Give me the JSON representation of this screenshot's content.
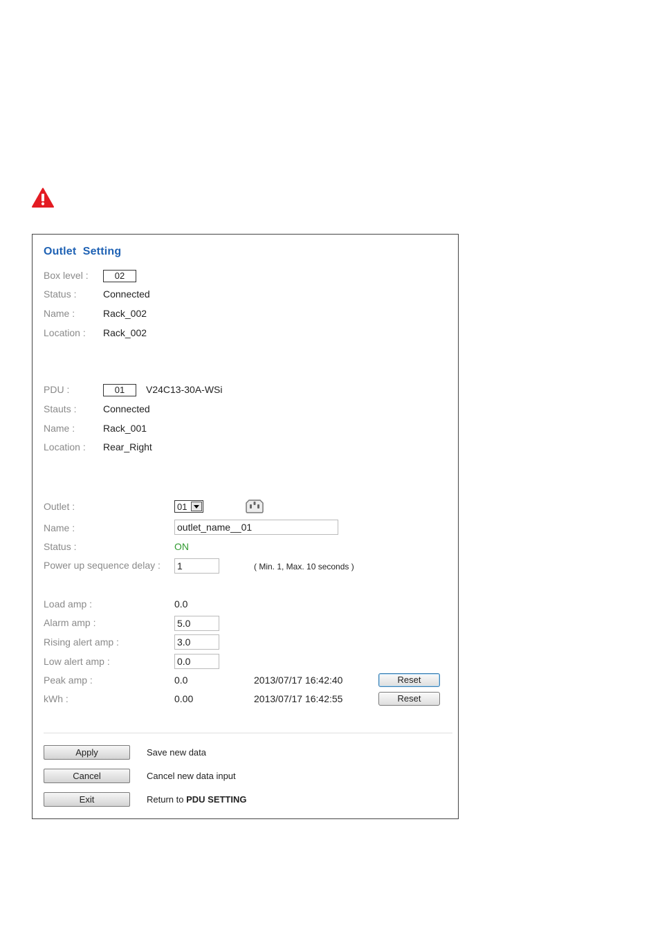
{
  "warning": {
    "icon": "warning-triangle-icon",
    "color": "#e31c23"
  },
  "panel": {
    "title": "Outlet  Setting",
    "title_color": "#1f62b4",
    "box": {
      "level_label": "Box level :",
      "level_value": "02",
      "status_label": "Status :",
      "status_value": "Connected",
      "name_label": "Name :",
      "name_value": "Rack_002",
      "location_label": "Location :",
      "location_value": "Rack_002"
    },
    "pdu": {
      "label": "PDU :",
      "value": "01",
      "model": "V24C13-30A-WSi",
      "status_label": "Stauts :",
      "status_value": "Connected",
      "name_label": "Name :",
      "name_value": "Rack_001",
      "location_label": "Location :",
      "location_value": "Rear_Right"
    },
    "outlet": {
      "label": "Outlet :",
      "selected": "01",
      "icon": "power-outlet-icon",
      "name_label": "Name :",
      "name_value": "outlet_name__01",
      "status_label": "Status :",
      "status_value": "ON",
      "status_color": "#2f9a2f",
      "delay_label": "Power up sequence delay :",
      "delay_value": "1",
      "delay_hint": "( Min. 1, Max. 10 seconds )"
    },
    "amps": {
      "load_label": "Load amp :",
      "load_value": "0.0",
      "alarm_label": "Alarm amp :",
      "alarm_value": "5.0",
      "rising_label": "Rising alert amp :",
      "rising_value": "3.0",
      "low_label": "Low alert amp :",
      "low_value": "0.0",
      "peak_label": "Peak amp :",
      "peak_value": "0.0",
      "peak_time": "2013/07/17 16:42:40",
      "kwh_label": "kWh :",
      "kwh_value": "0.00",
      "kwh_time": "2013/07/17 16:42:55",
      "reset_label": "Reset"
    },
    "actions": {
      "apply_label": "Apply",
      "apply_desc": "Save new data",
      "cancel_label": "Cancel",
      "cancel_desc": "Cancel new data input",
      "exit_label": "Exit",
      "exit_desc_prefix": "Return to ",
      "exit_desc_bold": "PDU SETTING"
    }
  }
}
